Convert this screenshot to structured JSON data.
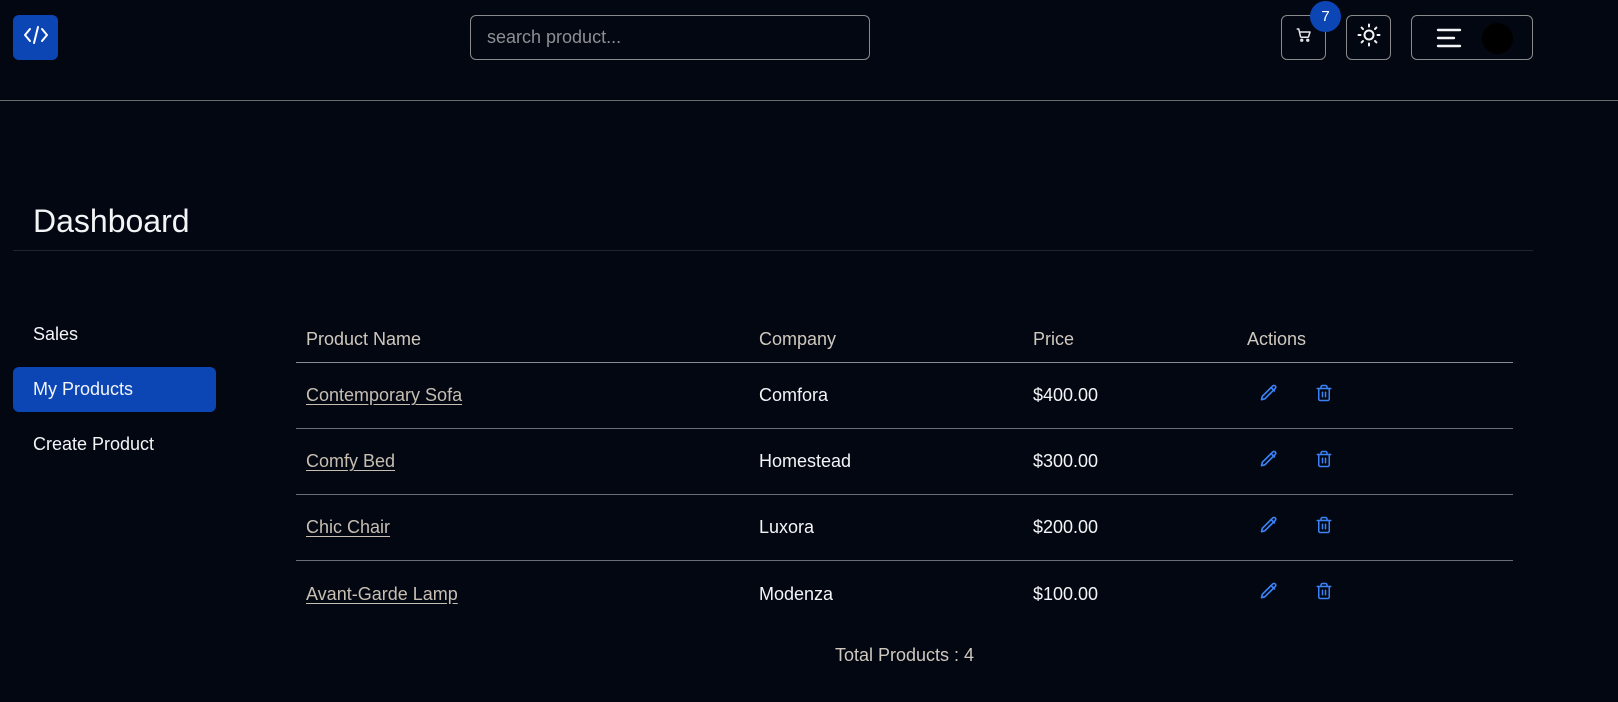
{
  "header": {
    "logo_icon": "code-icon",
    "search": {
      "placeholder": "search product...",
      "value": ""
    },
    "cart": {
      "icon": "cart-icon",
      "count": "7"
    },
    "theme_toggle": {
      "icon": "sun-icon"
    },
    "menu": {
      "icon": "hamburger-icon",
      "avatar": "avatar"
    }
  },
  "page": {
    "title": "Dashboard"
  },
  "sidebar": {
    "items": [
      {
        "label": "Sales",
        "active": false
      },
      {
        "label": "My Products",
        "active": true
      },
      {
        "label": "Create Product",
        "active": false
      }
    ]
  },
  "table": {
    "headers": {
      "name": "Product Name",
      "company": "Company",
      "price": "Price",
      "actions": "Actions"
    },
    "rows": [
      {
        "name": "Contemporary Sofa",
        "company": "Comfora",
        "price": "$400.00"
      },
      {
        "name": "Comfy Bed",
        "company": "Homestead",
        "price": "$300.00"
      },
      {
        "name": "Chic Chair",
        "company": "Luxora",
        "price": "$200.00"
      },
      {
        "name": "Avant-Garde Lamp",
        "company": "Modenza",
        "price": "$100.00"
      }
    ],
    "total_label": "Total Products : 4"
  },
  "colors": {
    "background": "#030712",
    "accent": "#0c46b4",
    "action_icon": "#3b82f6"
  }
}
